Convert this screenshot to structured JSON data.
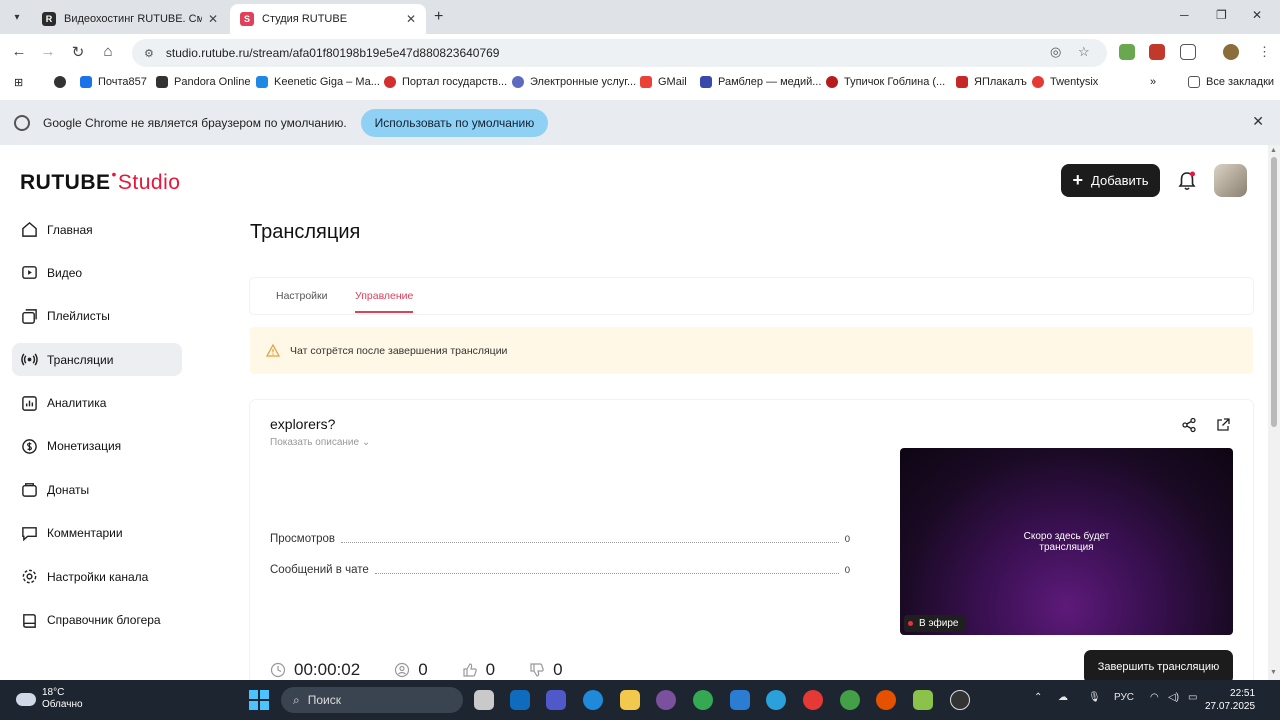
{
  "browser": {
    "tabs": [
      {
        "label": "Видеохостинг RUTUBE. Смотр",
        "favicon": "R",
        "color": "#2c2c2c"
      },
      {
        "label": "Студия RUTUBE",
        "favicon": "S",
        "color": "#e0405a"
      }
    ],
    "url": "studio.rutube.ru/stream/afa01f80198b19e5e47d880823640769",
    "bookmarks": [
      "Почта857",
      "Pandora Online",
      "Keenetic Giga – Ма...",
      "Портал государств...",
      "Электронные услуг...",
      "GMail",
      "Рамблер — медий...",
      "Тупичок Гоблина (...",
      "ЯПлакалъ",
      "Twentysix"
    ],
    "all_bookmarks": "Все закладки",
    "overflow": "»"
  },
  "infobar": {
    "message": "Google Chrome не является браузером по умолчанию.",
    "button": "Использовать по умолчанию"
  },
  "header": {
    "logo_main": "RUTUBE",
    "logo_dot": "•",
    "logo_studio": "Studio",
    "add_button": "Добавить"
  },
  "sidebar": {
    "items": [
      {
        "label": "Главная",
        "icon": "home-icon"
      },
      {
        "label": "Видео",
        "icon": "video-icon"
      },
      {
        "label": "Плейлисты",
        "icon": "playlist-icon"
      },
      {
        "label": "Трансляции",
        "icon": "broadcast-icon",
        "active": true
      },
      {
        "label": "Аналитика",
        "icon": "analytics-icon"
      },
      {
        "label": "Монетизация",
        "icon": "monetization-icon"
      },
      {
        "label": "Донаты",
        "icon": "donate-icon"
      },
      {
        "label": "Комментарии",
        "icon": "comments-icon"
      },
      {
        "label": "Настройки канала",
        "icon": "gear-icon"
      },
      {
        "label": "Справочник блогера",
        "icon": "book-icon"
      }
    ]
  },
  "main": {
    "title": "Трансляция",
    "tabs": [
      "Настройки",
      "Управление"
    ],
    "warning": "Чат сотрётся после завершения трансляции",
    "stream": {
      "title": "explorers?",
      "show_description": "Показать описание",
      "stats": [
        {
          "label": "Просмотров",
          "value": "0"
        },
        {
          "label": "Сообщений в чате",
          "value": "0"
        }
      ],
      "preview_line1": "Скоро здесь будет",
      "preview_line2": "трансляция",
      "live_label": "В эфире",
      "duration": "00:00:02",
      "viewers": "0",
      "likes": "0",
      "dislikes": "0",
      "end_button": "Завершить трансляцию"
    }
  },
  "taskbar": {
    "temperature": "18°C",
    "weather": "Облачно",
    "search": "Поиск",
    "lang": "РУС",
    "time": "22:51",
    "date": "27.07.2025"
  },
  "colors": {
    "accent": "#e0405a",
    "brand_red": "#ed143b",
    "dark_button": "#1c1c1c"
  }
}
